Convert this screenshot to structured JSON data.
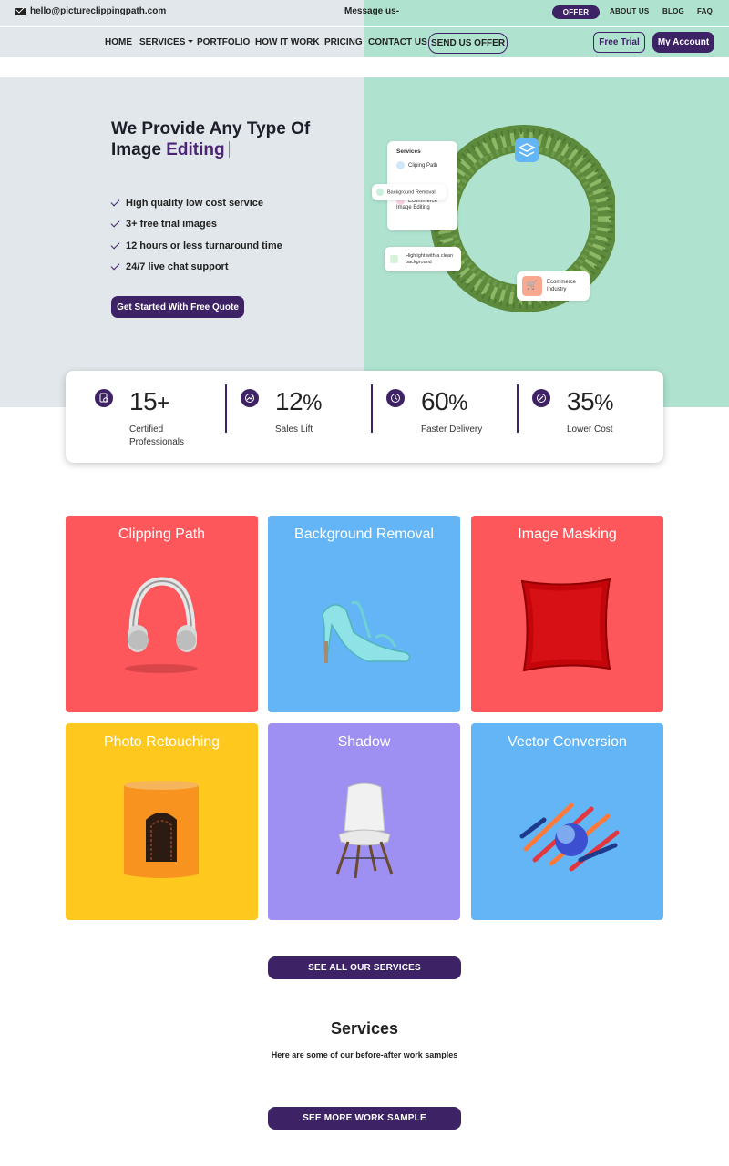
{
  "topbar": {
    "email": "hello@pictureclippingpath.com",
    "message": "Message us-",
    "offer": "OFFER",
    "links": [
      "ABOUT US",
      "BLOG",
      "FAQ"
    ]
  },
  "nav": {
    "items": [
      "HOME",
      "SERVICES",
      "PORTFOLIO",
      "HOW IT WORK",
      "PRICING",
      "CONTACT US"
    ],
    "send_offer": "SEND US OFFER",
    "free_trial": "Free Trial",
    "my_account": "My Account"
  },
  "hero": {
    "title_line1": "We Provide Any Type Of",
    "title_line2_prefix": "Image",
    "title_accent": "Editing",
    "features": [
      "High quality low cost service",
      "3+ free trial images",
      "12 hours or less turnaround time",
      "24/7 live chat support"
    ],
    "cta": "Get Started With Free Quote",
    "illustration": {
      "services_heading": "Services",
      "services": [
        "Cliping Path",
        "Background Removal",
        "Ecommerce Image Editing"
      ],
      "highlight_text": "Highlight with a clean background",
      "ecommerce_label": "Ecommerce Industry"
    }
  },
  "stats": [
    {
      "number": "15",
      "unit": "+",
      "label": "Certified Professionals"
    },
    {
      "number": "12",
      "unit": "%",
      "label": "Sales Lift"
    },
    {
      "number": "60",
      "unit": "%",
      "label": "Faster Delivery"
    },
    {
      "number": "35",
      "unit": "%",
      "label": "Lower Cost"
    }
  ],
  "services_grid": [
    {
      "title": "Clipping Path",
      "color": "#fd575c"
    },
    {
      "title": "Background Removal",
      "color": "#64b5f6"
    },
    {
      "title": "Image Masking",
      "color": "#fd575c"
    },
    {
      "title": "Photo Retouching",
      "color": "#ffc81f"
    },
    {
      "title": "Shadow",
      "color": "#9e8ff2"
    },
    {
      "title": "Vector Conversion",
      "color": "#64b5f6"
    }
  ],
  "see_all_services": "SEE ALL OUR SERVICES",
  "services_section": {
    "title": "Services",
    "subtitle": "Here are some of our before-after work samples"
  },
  "see_more_work": "SEE MORE WORK SAMPLE",
  "colors": {
    "brand": "#3d2265",
    "hero_left": "#e1e7ea",
    "hero_right": "#afe3cf"
  }
}
